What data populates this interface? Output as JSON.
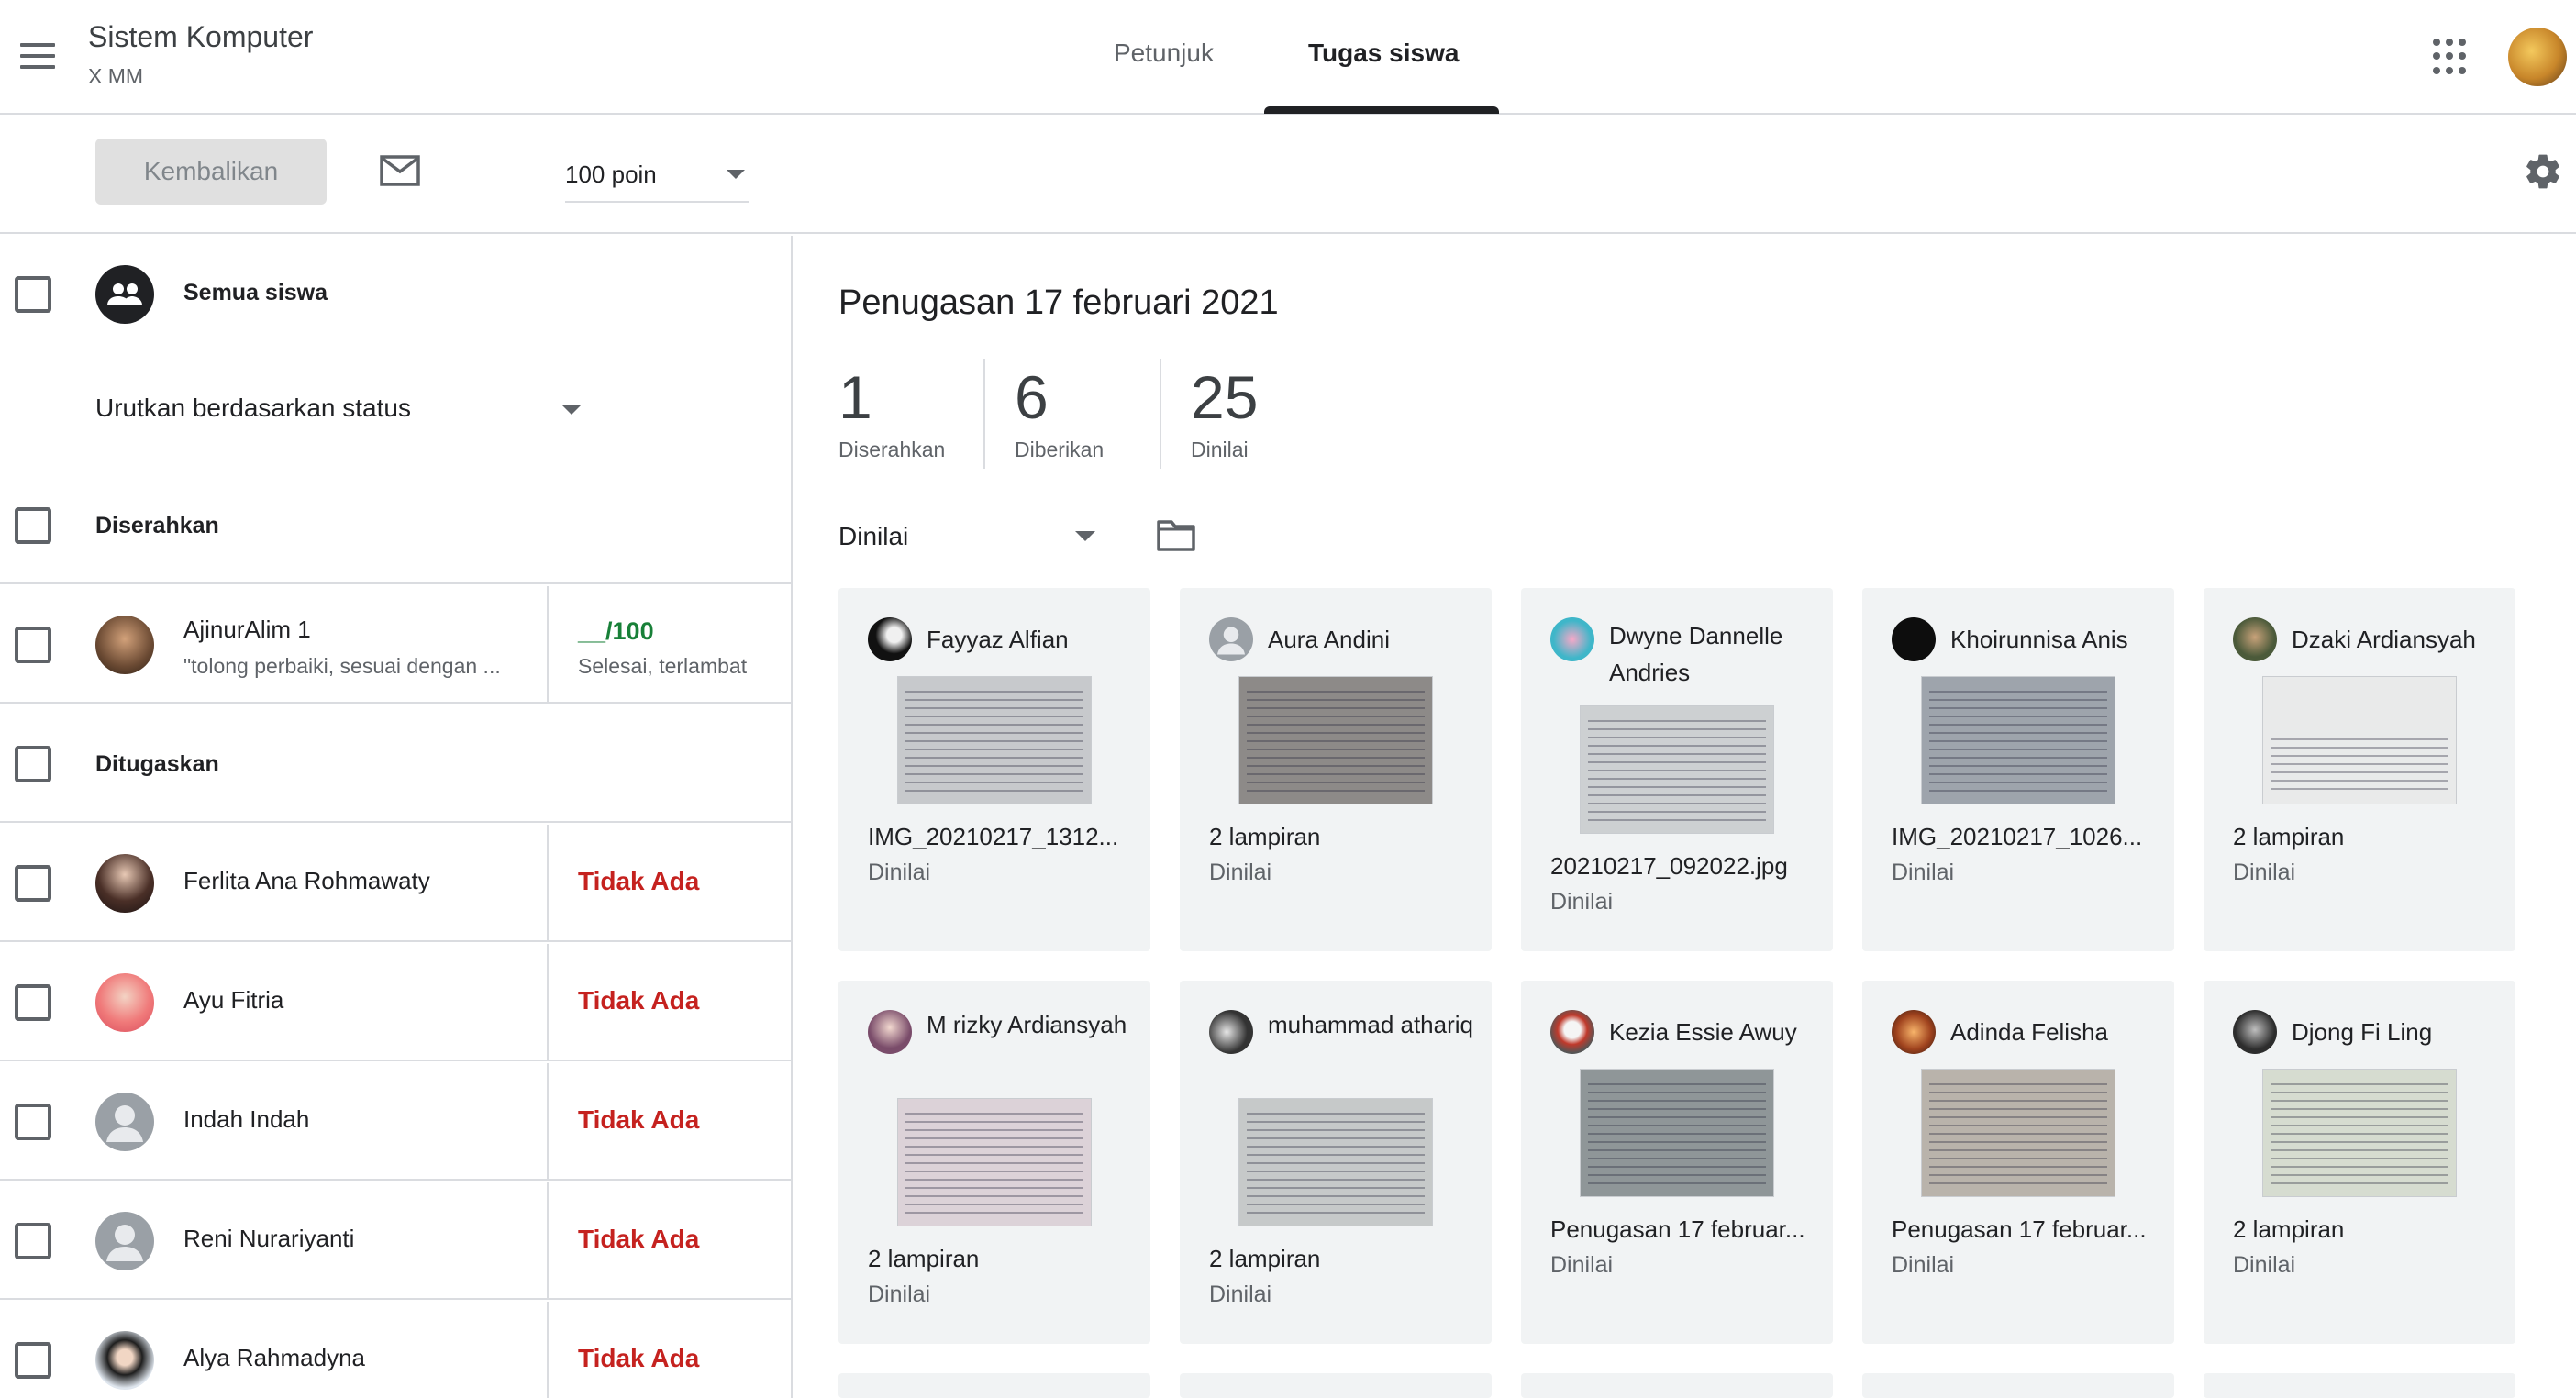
{
  "header": {
    "class_title": "Sistem Komputer",
    "class_subtitle": "X MM",
    "tabs": [
      {
        "label": "Petunjuk",
        "active": false
      },
      {
        "label": "Tugas siswa",
        "active": true
      }
    ]
  },
  "toolbar": {
    "return_label": "Kembalikan",
    "points": "100 poin"
  },
  "left": {
    "all_students": "Semua siswa",
    "sort_label": "Urutkan berdasarkan status",
    "sections": {
      "submitted": "Diserahkan",
      "assigned": "Ditugaskan"
    },
    "submitted_students": [
      {
        "name": "AjinurAlim 1",
        "comment": "\"tolong perbaiki, sesuai dengan ...",
        "score": "__/100",
        "status": "Selesai, terlambat"
      }
    ],
    "assigned_students": [
      {
        "name": "Ferlita Ana Rohmawaty",
        "status": "Tidak Ada"
      },
      {
        "name": "Ayu Fitria",
        "status": "Tidak Ada"
      },
      {
        "name": "Indah Indah",
        "status": "Tidak Ada"
      },
      {
        "name": "Reni Nurariyanti",
        "status": "Tidak Ada"
      },
      {
        "name": "Alya Rahmadyna",
        "status": "Tidak Ada"
      }
    ]
  },
  "main": {
    "assignment_title": "Penugasan 17 februari 2021",
    "stats": [
      {
        "value": "1",
        "label": "Diserahkan"
      },
      {
        "value": "6",
        "label": "Diberikan"
      },
      {
        "value": "25",
        "label": "Dinilai"
      }
    ],
    "filter": "Dinilai",
    "cards": [
      {
        "name": "Fayyaz Alfian",
        "file": "IMG_20210217_1312...",
        "status": "Dinilai"
      },
      {
        "name": "Aura Andini",
        "file": "2 lampiran",
        "status": "Dinilai"
      },
      {
        "name": "Dwyne Dannelle Andries",
        "file": "20210217_092022.jpg",
        "status": "Dinilai"
      },
      {
        "name": "Khoirunnisa Anis",
        "file": "IMG_20210217_1026...",
        "status": "Dinilai"
      },
      {
        "name": "Dzaki Ardiansyah",
        "file": "2 lampiran",
        "status": "Dinilai"
      },
      {
        "name": "M rizky Ardiansyah",
        "file": "2 lampiran",
        "status": "Dinilai"
      },
      {
        "name": "muhammad athariq",
        "file": "2 lampiran",
        "status": "Dinilai"
      },
      {
        "name": "Kezia Essie Awuy",
        "file": "Penugasan 17 februar...",
        "status": "Dinilai"
      },
      {
        "name": "Adinda Felisha",
        "file": "Penugasan 17 februar...",
        "status": "Dinilai"
      },
      {
        "name": "Djong Fi Ling",
        "file": "2 lampiran",
        "status": "Dinilai"
      }
    ]
  },
  "colors": {
    "missing": "#c5221f",
    "score": "#188038",
    "card_bg": "#f1f3f4"
  }
}
